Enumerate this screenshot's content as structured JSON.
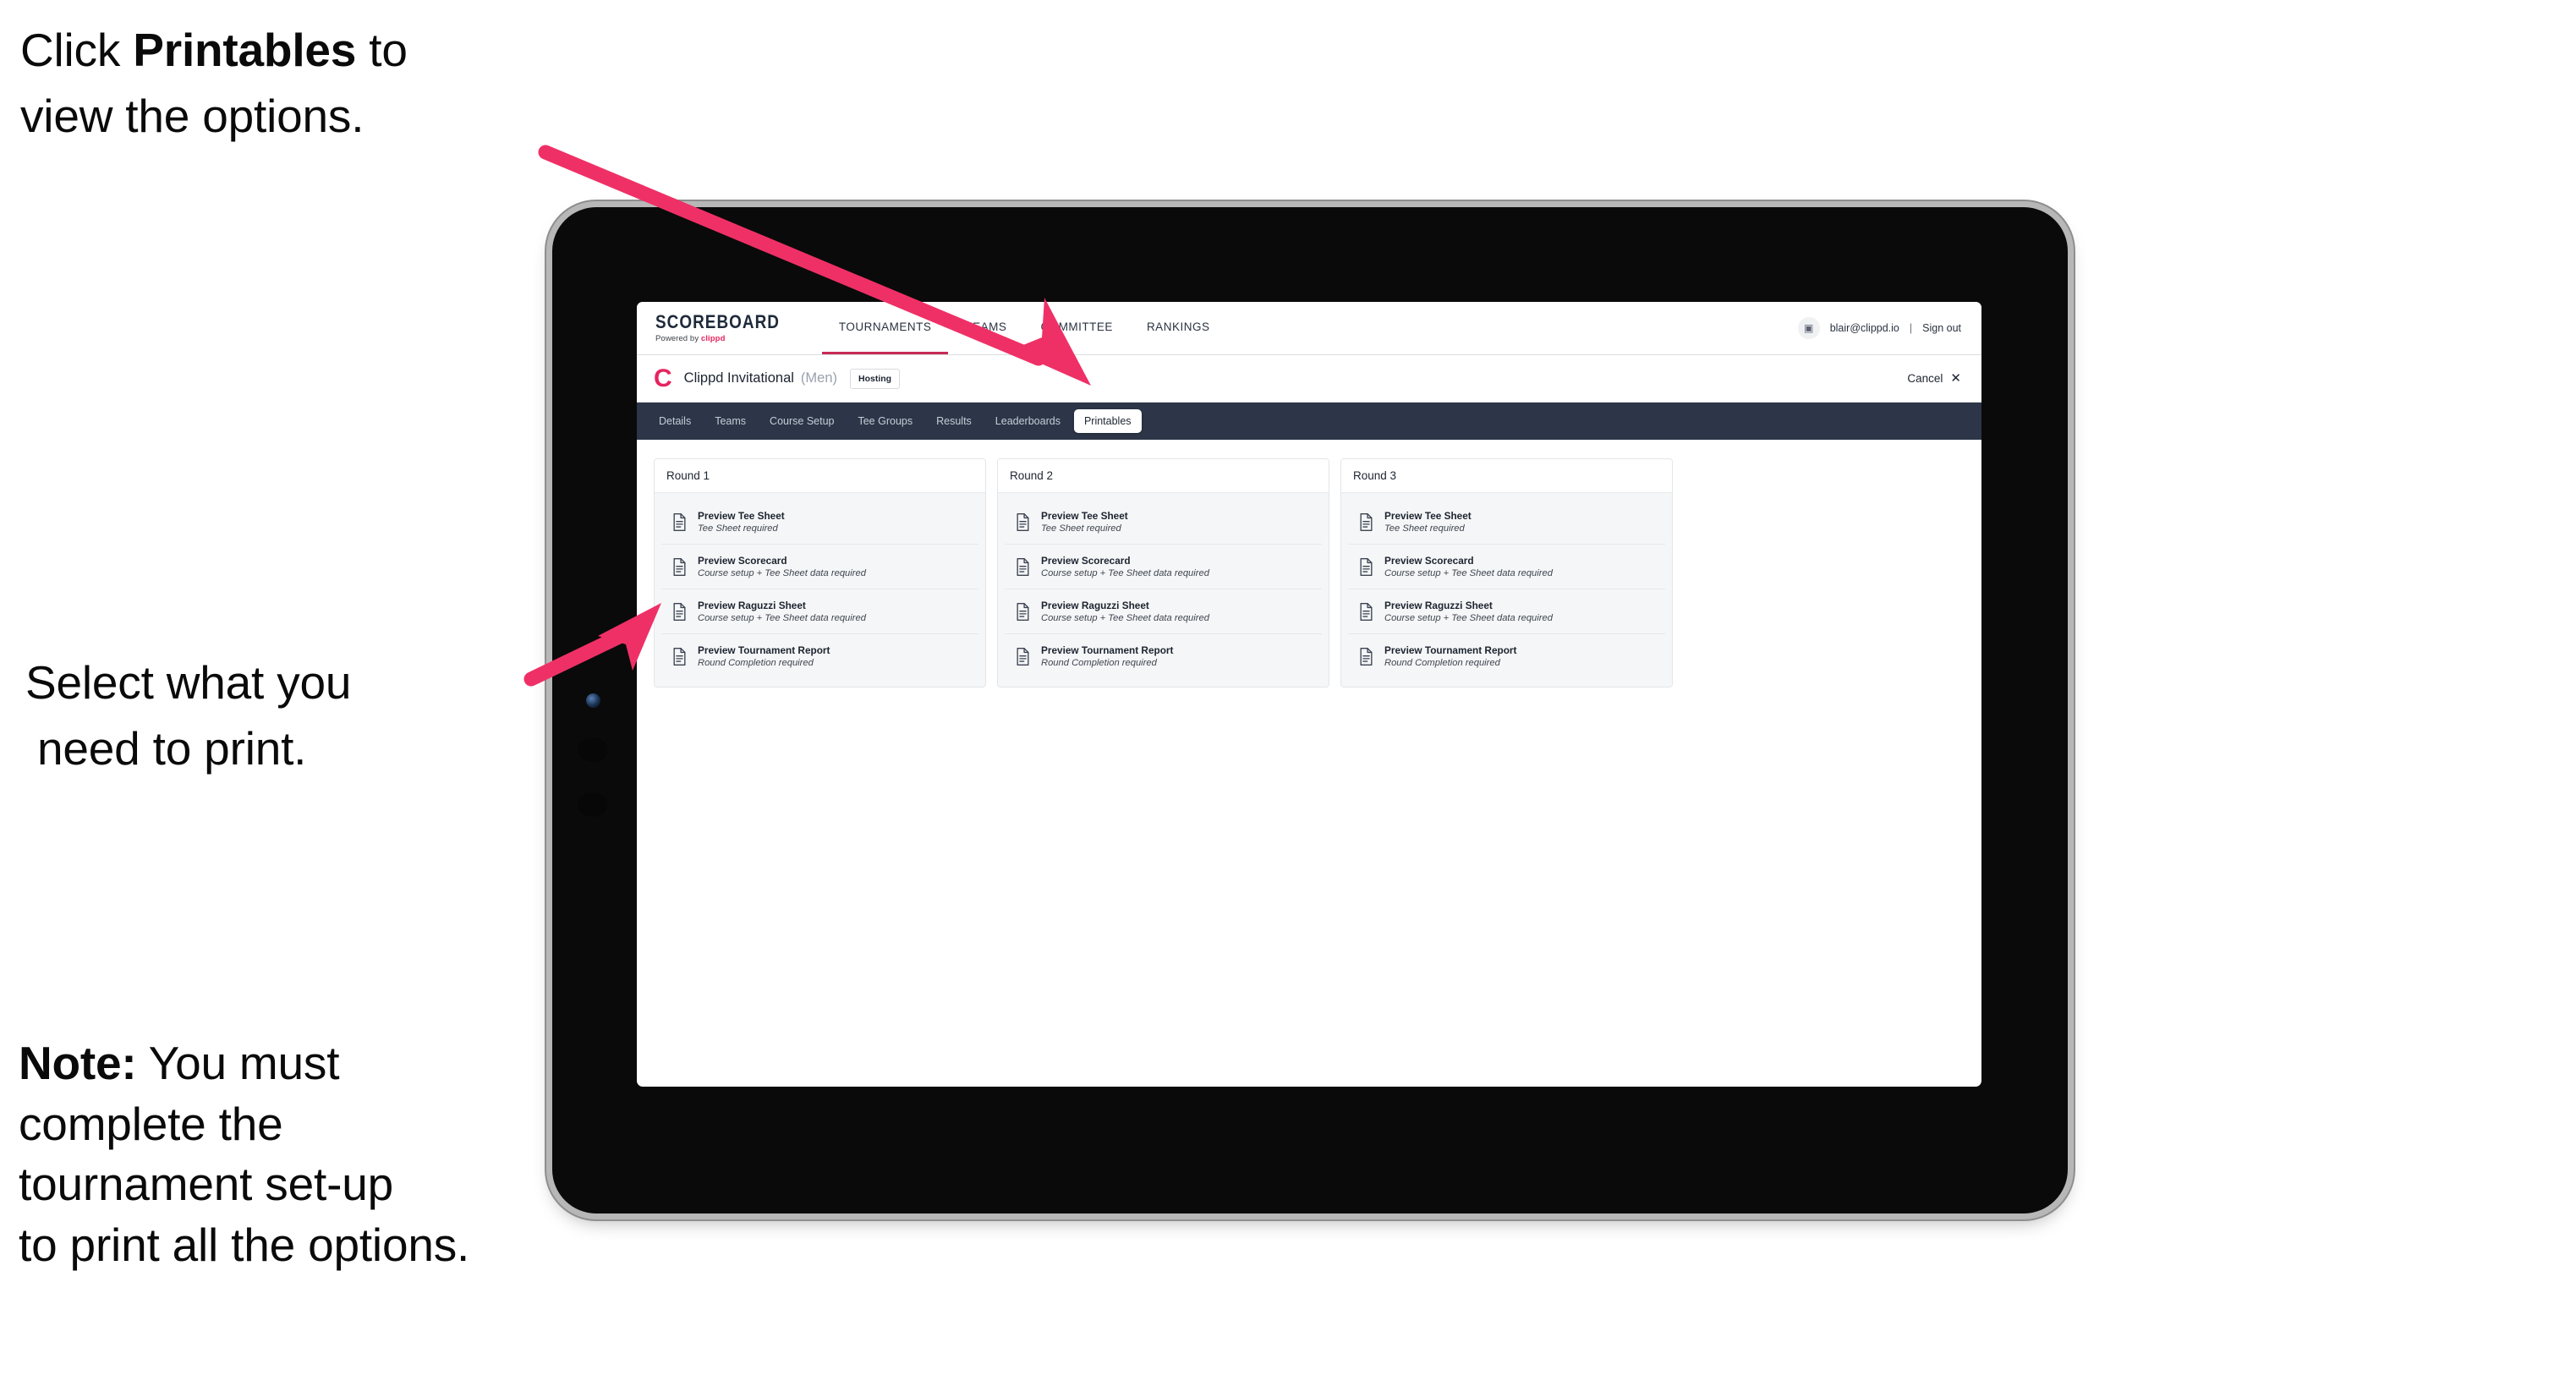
{
  "annotations": {
    "callout_1_line1_pre": "Click ",
    "callout_1_bold": "Printables",
    "callout_1_line1_post": " to",
    "callout_1_line2": "view the options.",
    "callout_2_line1": "Select what you",
    "callout_2_line2": "need to print.",
    "callout_3_bold": "Note:",
    "callout_3_line1_post": " You must",
    "callout_3_line2": "complete the",
    "callout_3_line3": "tournament set-up",
    "callout_3_line4": "to print all the options.",
    "arrow_color": "#ef3066"
  },
  "app": {
    "brand": {
      "title": "SCOREBOARD",
      "powered_by_prefix": "Powered by ",
      "powered_by_name": "clippd",
      "accent": "#e6245f"
    },
    "global_nav": [
      {
        "label": "TOURNAMENTS",
        "active": true
      },
      {
        "label": "TEAMS",
        "active": false
      },
      {
        "label": "COMMITTEE",
        "active": false
      },
      {
        "label": "RANKINGS",
        "active": false
      }
    ],
    "account": {
      "avatar_glyph": "▣",
      "email": "blair@clippd.io",
      "separator": "|",
      "sign_out": "Sign out"
    },
    "tournament": {
      "mark": "C",
      "name": "Clippd Invitational",
      "gender": "(Men)",
      "status_badge": "Hosting",
      "cancel_label": "Cancel",
      "cancel_glyph": "✕"
    },
    "sub_tabs": [
      {
        "label": "Details",
        "active": false
      },
      {
        "label": "Teams",
        "active": false
      },
      {
        "label": "Course Setup",
        "active": false
      },
      {
        "label": "Tee Groups",
        "active": false
      },
      {
        "label": "Results",
        "active": false
      },
      {
        "label": "Leaderboards",
        "active": false
      },
      {
        "label": "Printables",
        "active": true
      }
    ],
    "rounds": [
      {
        "header": "Round 1",
        "items": [
          {
            "title": "Preview Tee Sheet",
            "requirement": "Tee Sheet required"
          },
          {
            "title": "Preview Scorecard",
            "requirement": "Course setup + Tee Sheet data required"
          },
          {
            "title": "Preview Raguzzi Sheet",
            "requirement": "Course setup + Tee Sheet data required"
          },
          {
            "title": "Preview Tournament Report",
            "requirement": "Round Completion required"
          }
        ]
      },
      {
        "header": "Round 2",
        "items": [
          {
            "title": "Preview Tee Sheet",
            "requirement": "Tee Sheet required"
          },
          {
            "title": "Preview Scorecard",
            "requirement": "Course setup + Tee Sheet data required"
          },
          {
            "title": "Preview Raguzzi Sheet",
            "requirement": "Course setup + Tee Sheet data required"
          },
          {
            "title": "Preview Tournament Report",
            "requirement": "Round Completion required"
          }
        ]
      },
      {
        "header": "Round 3",
        "items": [
          {
            "title": "Preview Tee Sheet",
            "requirement": "Tee Sheet required"
          },
          {
            "title": "Preview Scorecard",
            "requirement": "Course setup + Tee Sheet data required"
          },
          {
            "title": "Preview Raguzzi Sheet",
            "requirement": "Course setup + Tee Sheet data required"
          },
          {
            "title": "Preview Tournament Report",
            "requirement": "Round Completion required"
          }
        ]
      }
    ]
  }
}
